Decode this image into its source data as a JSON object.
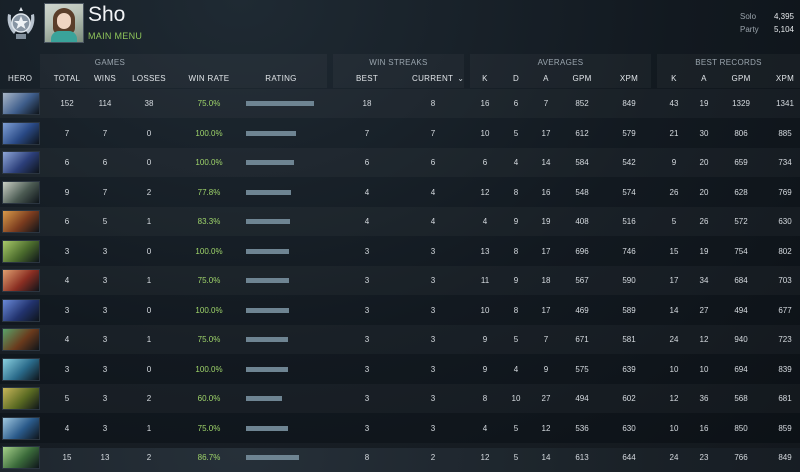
{
  "header": {
    "player_name": "Sho",
    "menu_label": "MAIN MENU",
    "rank_icon": "rank-medal-icon",
    "solo_label": "Solo",
    "solo_value": "4,395",
    "party_label": "Party",
    "party_value": "5,104"
  },
  "groups": {
    "games": "GAMES",
    "win_streaks": "WIN STREAKS",
    "averages": "AVERAGES",
    "best_records": "BEST RECORDS"
  },
  "columns": {
    "hero": "HERO",
    "total": "TOTAL",
    "wins": "WINS",
    "losses": "LOSSES",
    "win_rate": "WIN RATE",
    "rating": "RATING",
    "best": "BEST",
    "current": "CURRENT",
    "avg_k": "K",
    "avg_d": "D",
    "avg_a": "A",
    "avg_gpm": "GPM",
    "avg_xpm": "XPM",
    "rec_k": "K",
    "rec_a": "A",
    "rec_gpm": "GPM",
    "rec_xpm": "XPM"
  },
  "colors": {
    "accent_green": "#8fc55a",
    "win_rate": "#9ed36a",
    "rating_bar": "#6e8492"
  },
  "rows": [
    {
      "hero_icon": "hero-portrait-icon",
      "c1": "#3f5e8c",
      "c2": "#a9b7c8",
      "total": "152",
      "wins": "114",
      "losses": "38",
      "win_rate": "75.0%",
      "rating": 0.95,
      "best": "18",
      "current": "8",
      "k": "16",
      "d": "6",
      "a": "7",
      "gpm": "852",
      "xpm": "849",
      "rk": "43",
      "ra": "19",
      "rgpm": "1329",
      "rxpm": "1341"
    },
    {
      "hero_icon": "hero-portrait-icon",
      "c1": "#2a4a86",
      "c2": "#7fa0d6",
      "total": "7",
      "wins": "7",
      "losses": "0",
      "win_rate": "100.0%",
      "rating": 0.69,
      "best": "7",
      "current": "7",
      "k": "10",
      "d": "5",
      "a": "17",
      "gpm": "612",
      "xpm": "579",
      "rk": "21",
      "ra": "30",
      "rgpm": "806",
      "rxpm": "885"
    },
    {
      "hero_icon": "hero-portrait-icon",
      "c1": "#2c3f7a",
      "c2": "#8ea6d8",
      "total": "6",
      "wins": "6",
      "losses": "0",
      "win_rate": "100.0%",
      "rating": 0.67,
      "best": "6",
      "current": "6",
      "k": "6",
      "d": "4",
      "a": "14",
      "gpm": "584",
      "xpm": "542",
      "rk": "9",
      "ra": "20",
      "rgpm": "659",
      "rxpm": "734"
    },
    {
      "hero_icon": "hero-portrait-icon",
      "c1": "#4b5a52",
      "c2": "#c9cfc4",
      "total": "9",
      "wins": "7",
      "losses": "2",
      "win_rate": "77.8%",
      "rating": 0.63,
      "best": "4",
      "current": "4",
      "k": "12",
      "d": "8",
      "a": "16",
      "gpm": "548",
      "xpm": "574",
      "rk": "26",
      "ra": "20",
      "rgpm": "628",
      "rxpm": "769"
    },
    {
      "hero_icon": "hero-portrait-icon",
      "c1": "#7a3b1e",
      "c2": "#d89a4a",
      "total": "6",
      "wins": "5",
      "losses": "1",
      "win_rate": "83.3%",
      "rating": 0.61,
      "best": "4",
      "current": "4",
      "k": "4",
      "d": "9",
      "a": "19",
      "gpm": "408",
      "xpm": "516",
      "rk": "5",
      "ra": "26",
      "rgpm": "572",
      "rxpm": "630"
    },
    {
      "hero_icon": "hero-portrait-icon",
      "c1": "#4a6a2c",
      "c2": "#a8c96a",
      "total": "3",
      "wins": "3",
      "losses": "0",
      "win_rate": "100.0%",
      "rating": 0.6,
      "best": "3",
      "current": "3",
      "k": "13",
      "d": "8",
      "a": "17",
      "gpm": "696",
      "xpm": "746",
      "rk": "15",
      "ra": "19",
      "rgpm": "754",
      "rxpm": "802"
    },
    {
      "hero_icon": "hero-portrait-icon",
      "c1": "#8a2e22",
      "c2": "#e0a070",
      "total": "4",
      "wins": "3",
      "losses": "1",
      "win_rate": "75.0%",
      "rating": 0.6,
      "best": "3",
      "current": "3",
      "k": "11",
      "d": "9",
      "a": "18",
      "gpm": "567",
      "xpm": "590",
      "rk": "17",
      "ra": "34",
      "rgpm": "684",
      "rxpm": "703"
    },
    {
      "hero_icon": "hero-portrait-icon",
      "c1": "#22336e",
      "c2": "#6a8ad8",
      "total": "3",
      "wins": "3",
      "losses": "0",
      "win_rate": "100.0%",
      "rating": 0.6,
      "best": "3",
      "current": "3",
      "k": "10",
      "d": "8",
      "a": "17",
      "gpm": "469",
      "xpm": "589",
      "rk": "14",
      "ra": "27",
      "rgpm": "494",
      "rxpm": "677"
    },
    {
      "hero_icon": "hero-portrait-icon",
      "c1": "#6a3a1c",
      "c2": "#5aa26a",
      "total": "4",
      "wins": "3",
      "losses": "1",
      "win_rate": "75.0%",
      "rating": 0.58,
      "best": "3",
      "current": "3",
      "k": "9",
      "d": "5",
      "a": "7",
      "gpm": "671",
      "xpm": "581",
      "rk": "24",
      "ra": "12",
      "rgpm": "940",
      "rxpm": "723"
    },
    {
      "hero_icon": "hero-portrait-icon",
      "c1": "#2a6a8a",
      "c2": "#8ad0e0",
      "total": "3",
      "wins": "3",
      "losses": "0",
      "win_rate": "100.0%",
      "rating": 0.58,
      "best": "3",
      "current": "3",
      "k": "9",
      "d": "4",
      "a": "9",
      "gpm": "575",
      "xpm": "639",
      "rk": "10",
      "ra": "10",
      "rgpm": "694",
      "rxpm": "839"
    },
    {
      "hero_icon": "hero-portrait-icon",
      "c1": "#5a6a22",
      "c2": "#c8b65a",
      "total": "5",
      "wins": "3",
      "losses": "2",
      "win_rate": "60.0%",
      "rating": 0.5,
      "best": "3",
      "current": "3",
      "k": "8",
      "d": "10",
      "a": "27",
      "gpm": "494",
      "xpm": "602",
      "rk": "12",
      "ra": "36",
      "rgpm": "568",
      "rxpm": "681"
    },
    {
      "hero_icon": "hero-portrait-icon",
      "c1": "#2a5a8a",
      "c2": "#a0c8e0",
      "total": "4",
      "wins": "3",
      "losses": "1",
      "win_rate": "75.0%",
      "rating": 0.58,
      "best": "3",
      "current": "3",
      "k": "4",
      "d": "5",
      "a": "12",
      "gpm": "536",
      "xpm": "630",
      "rk": "10",
      "ra": "16",
      "rgpm": "850",
      "rxpm": "859"
    },
    {
      "hero_icon": "hero-portrait-icon",
      "c1": "#3a6a3a",
      "c2": "#a6d08a",
      "total": "15",
      "wins": "13",
      "losses": "2",
      "win_rate": "86.7%",
      "rating": 0.74,
      "best": "8",
      "current": "2",
      "k": "12",
      "d": "5",
      "a": "14",
      "gpm": "613",
      "xpm": "644",
      "rk": "24",
      "ra": "23",
      "rgpm": "766",
      "rxpm": "849"
    }
  ]
}
